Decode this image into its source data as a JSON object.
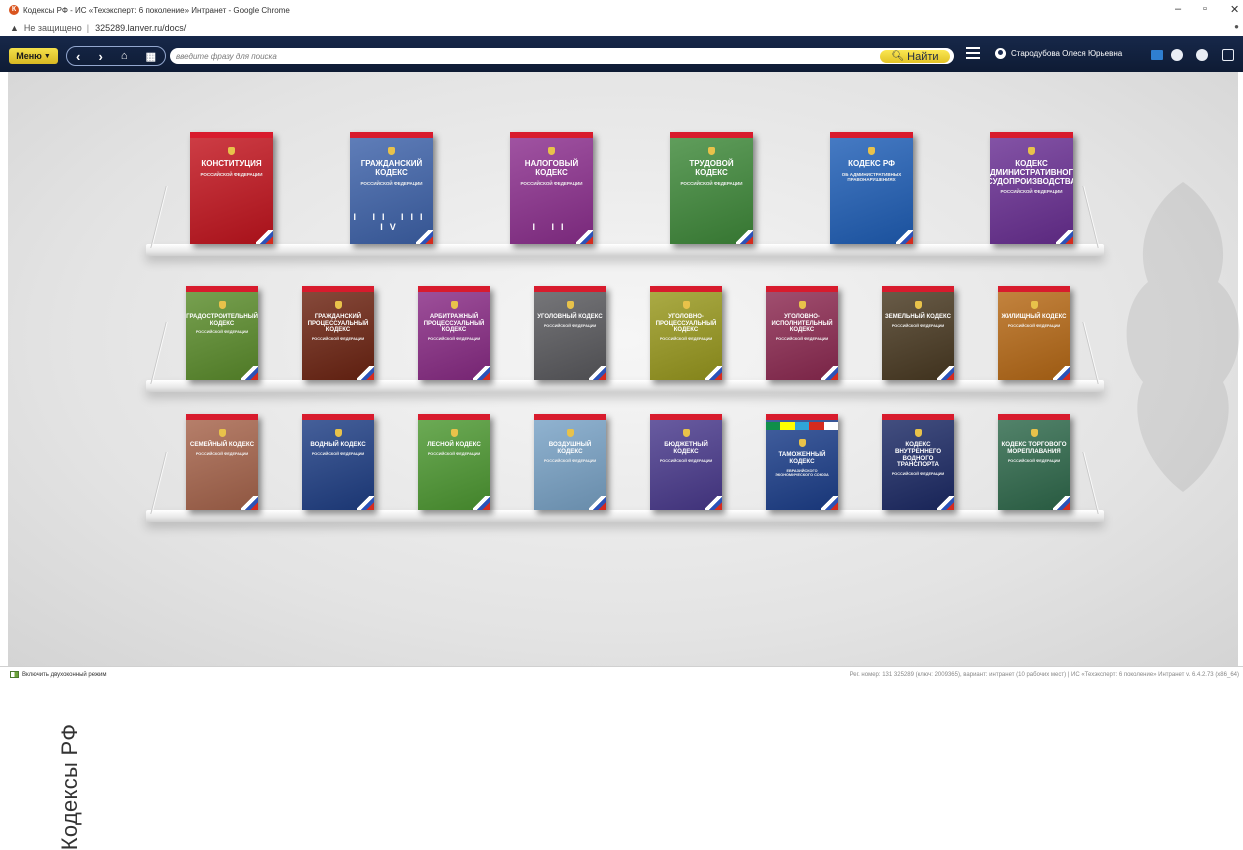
{
  "window": {
    "title": "Кодексы РФ - ИС «Техэксперт: 6 поколение» Интранет - Google Chrome",
    "security": "Не защищено",
    "url": "325289.lanver.ru/docs/",
    "controls": [
      "–",
      "▫",
      "✕"
    ]
  },
  "toolbar": {
    "menu_label": "Меню",
    "search_placeholder": "введите фразу для поиска",
    "find_label": "Найти",
    "user_name": "Стародубова Олеся Юрьевна"
  },
  "page": {
    "title": "Кодексы РФ"
  },
  "shelves": [
    {
      "books": [
        {
          "title": "КОНСТИТУЦИЯ",
          "subtitle": "РОССИЙСКОЙ ФЕДЕРАЦИИ",
          "roman": "",
          "color": "#c4141e"
        },
        {
          "title": "ГРАЖДАНСКИЙ КОДЕКС",
          "subtitle": "РОССИЙСКОЙ ФЕДЕРАЦИИ",
          "roman": "I II III IV",
          "color": "#3e63ab"
        },
        {
          "title": "НАЛОГОВЫЙ КОДЕКС",
          "subtitle": "РОССИЙСКОЙ ФЕДЕРАЦИИ",
          "roman": "I II",
          "color": "#8d2f8f"
        },
        {
          "title": "ТРУДОВОЙ КОДЕКС",
          "subtitle": "РОССИЙСКОЙ ФЕДЕРАЦИИ",
          "roman": "",
          "color": "#3f8a3a"
        },
        {
          "title": "КОДЕКС РФ",
          "subtitle": "ОБ АДМИНИСТРАТИВНЫХ ПРАВОНАРУШЕНИЯХ",
          "roman": "",
          "color": "#1f5fb8"
        },
        {
          "title": "КОДЕКС АДМИНИСТРАТИВНОГО СУДОПРОИЗВОДСТВА",
          "subtitle": "РОССИЙСКОЙ ФЕДЕРАЦИИ",
          "roman": "",
          "color": "#6a2f94"
        }
      ]
    },
    {
      "books": [
        {
          "title": "ГРАДОСТРОИТЕЛЬНЫЙ КОДЕКС",
          "subtitle": "РОССИЙСКОЙ ФЕДЕРАЦИИ",
          "roman": "",
          "color": "#5c8e2c"
        },
        {
          "title": "ГРАЖДАНСКИЙ ПРОЦЕССУАЛЬНЫЙ КОДЕКС",
          "subtitle": "РОССИЙСКОЙ ФЕДЕРАЦИИ",
          "roman": "",
          "color": "#6e2412"
        },
        {
          "title": "АРБИТРАЖНЫЙ ПРОЦЕССУАЛЬНЫЙ КОДЕКС",
          "subtitle": "РОССИЙСКОЙ ФЕДЕРАЦИИ",
          "roman": "",
          "color": "#8a2b86"
        },
        {
          "title": "УГОЛОВНЫЙ КОДЕКС",
          "subtitle": "РОССИЙСКОЙ ФЕДЕРАЦИИ",
          "roman": "",
          "color": "#5a5a5e"
        },
        {
          "title": "УГОЛОВНО-ПРОЦЕССУАЛЬНЫЙ КОДЕКС",
          "subtitle": "РОССИЙСКОЙ ФЕДЕРАЦИИ",
          "roman": "",
          "color": "#9a9a1e"
        },
        {
          "title": "УГОЛОВНО-ИСПОЛНИТЕЛЬНЫЙ КОДЕКС",
          "subtitle": "РОССИЙСКОЙ ФЕДЕРАЦИИ",
          "roman": "",
          "color": "#8e2a52"
        },
        {
          "title": "ЗЕМЕЛЬНЫЙ КОДЕКС",
          "subtitle": "РОССИЙСКОЙ ФЕДЕРАЦИИ",
          "roman": "",
          "color": "#4a3a22"
        },
        {
          "title": "ЖИЛИЩНЫЙ КОДЕКС",
          "subtitle": "РОССИЙСКОЙ ФЕДЕРАЦИИ",
          "roman": "",
          "color": "#b86a16"
        }
      ]
    },
    {
      "books": [
        {
          "title": "СЕМЕЙНЫЙ КОДЕКС",
          "subtitle": "РОССИЙСКОЙ ФЕДЕРАЦИИ",
          "roman": "",
          "color": "#a8654c"
        },
        {
          "title": "ВОДНЫЙ КОДЕКС",
          "subtitle": "РОССИЙСКОЙ ФЕДЕРАЦИИ",
          "roman": "",
          "color": "#1f3f86"
        },
        {
          "title": "ЛЕСНОЙ КОДЕКС",
          "subtitle": "РОССИЙСКОЙ ФЕДЕРАЦИИ",
          "roman": "",
          "color": "#4e9a32"
        },
        {
          "title": "ВОЗДУШНЫЙ КОДЕКС",
          "subtitle": "РОССИЙСКОЙ ФЕДЕРАЦИИ",
          "roman": "",
          "color": "#7aa4c8"
        },
        {
          "title": "БЮДЖЕТНЫЙ КОДЕКС",
          "subtitle": "РОССИЙСКОЙ ФЕДЕРАЦИИ",
          "roman": "",
          "color": "#4a3a8e"
        },
        {
          "title": "ТАМОЖЕННЫЙ КОДЕКС",
          "subtitle": "ЕВРАЗИЙСКОГО ЭКОНОМИЧЕСКОГО СОЮЗА",
          "roman": "",
          "color": "#1c3f8c"
        },
        {
          "title": "КОДЕКС ВНУТРЕННЕГО ВОДНОГО ТРАНСПОРТА",
          "subtitle": "РОССИЙСКОЙ ФЕДЕРАЦИИ",
          "roman": "",
          "color": "#1c2a66"
        },
        {
          "title": "КОДЕКС ТОРГОВОГО МОРЕПЛАВАНИЯ",
          "subtitle": "РОССИЙСКОЙ ФЕДЕРАЦИИ",
          "roman": "",
          "color": "#2f6a4c"
        }
      ]
    }
  ],
  "status": {
    "dual_mode": "Включить двухоконный режим",
    "info": "Рег. номер: 131 325289 (ключ: 2009365), вариант: интранет (10 рабочих мест)  |  ИС «Техэксперт: 6 поколение» Интранет v. 6.4.2.73 (x86_64)"
  }
}
